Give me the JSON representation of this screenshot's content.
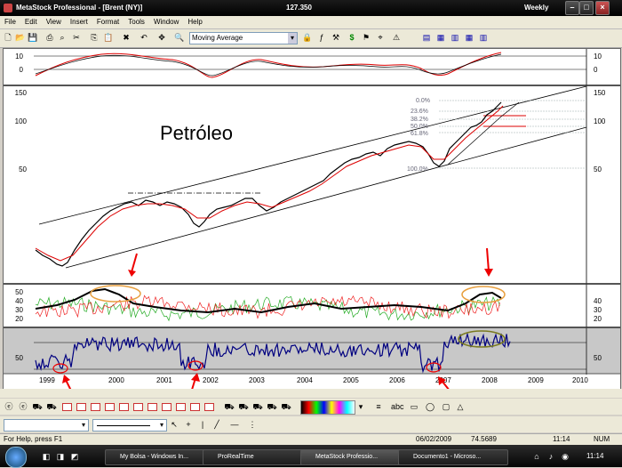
{
  "window": {
    "title": "MetaStock Professional - [Brent (NY)]",
    "price": "127.350",
    "periodicity": "Weekly"
  },
  "menu": [
    "File",
    "Edit",
    "View",
    "Insert",
    "Format",
    "Tools",
    "Window",
    "Help"
  ],
  "toolbar": {
    "indicator_select": "Moving Average"
  },
  "chart": {
    "annotation": "Petróleo",
    "fib_levels": [
      "0.0%",
      "23.6%",
      "38.2%",
      "50.0%",
      "61.8%",
      "100.0%"
    ],
    "price_axis": [
      "150",
      "100",
      "50"
    ],
    "momentum_axis": [
      "10",
      "0"
    ],
    "dmi_axis": [
      "50",
      "40",
      "30",
      "20"
    ],
    "rsi_axis": [
      "50"
    ],
    "years": [
      "1999",
      "2000",
      "2001",
      "2002",
      "2003",
      "2004",
      "2005",
      "2006",
      "2007",
      "2008",
      "2009",
      "2010"
    ]
  },
  "status": {
    "help": "For Help, press F1",
    "date": "06/02/2009",
    "value": "74.5689",
    "time": "11:14",
    "num": "NUM"
  },
  "taskbar": {
    "items": [
      "My Bolsa - Windows In...",
      "ProRealTime",
      "MetaStock Professio...",
      "Documento1 - Microso..."
    ],
    "clock": "11:14"
  },
  "colors": {
    "accent": "#000080",
    "price": "#000000",
    "ma_red": "#dd0000",
    "arrow_red": "#ee0000",
    "oval_orange": "#e8a040",
    "oval_olive": "#7a7a20",
    "fib": "#9aa0a0"
  }
}
